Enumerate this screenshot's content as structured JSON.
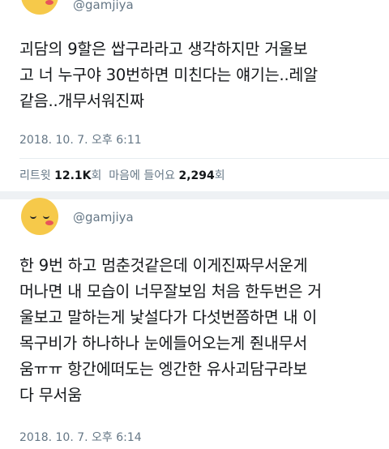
{
  "tweets": [
    {
      "handle": "@gamjiya",
      "text": "괴담의 9할은 쌉구라라고 생각하지만 거울보\n고 너 누구야 30번하면 미친다는 얘기는..레알\n같음..개무서워진짜",
      "timestamp": "2018. 10. 7. 오후 6:11",
      "stats": {
        "retweet_label": "리트윗",
        "retweet_count": "12.1K",
        "retweet_unit": "회",
        "like_label": "마음에 들어요",
        "like_count": "2,294",
        "like_unit": "회"
      }
    },
    {
      "handle": "@gamjiya",
      "text": "한 9번 하고 멈춘것같은데 이게진짜무서운게\n머나면 내 모습이 너무잘보임 처음 한두번은 거\n울보고 말하는게 낯설다가 다섯번쯤하면 내 이\n목구비가 하나하나 눈에들어오는게 줜내무서\n움ㅠㅠ 항간에떠도는 엥간한 유사괴담구라보\n다 무서움",
      "timestamp": "2018. 10. 7. 오후 6:14"
    }
  ],
  "colors": {
    "avatar": "#f6c94a",
    "text_primary": "#14171a",
    "text_secondary": "#657786",
    "divider": "#e6ecf0"
  }
}
